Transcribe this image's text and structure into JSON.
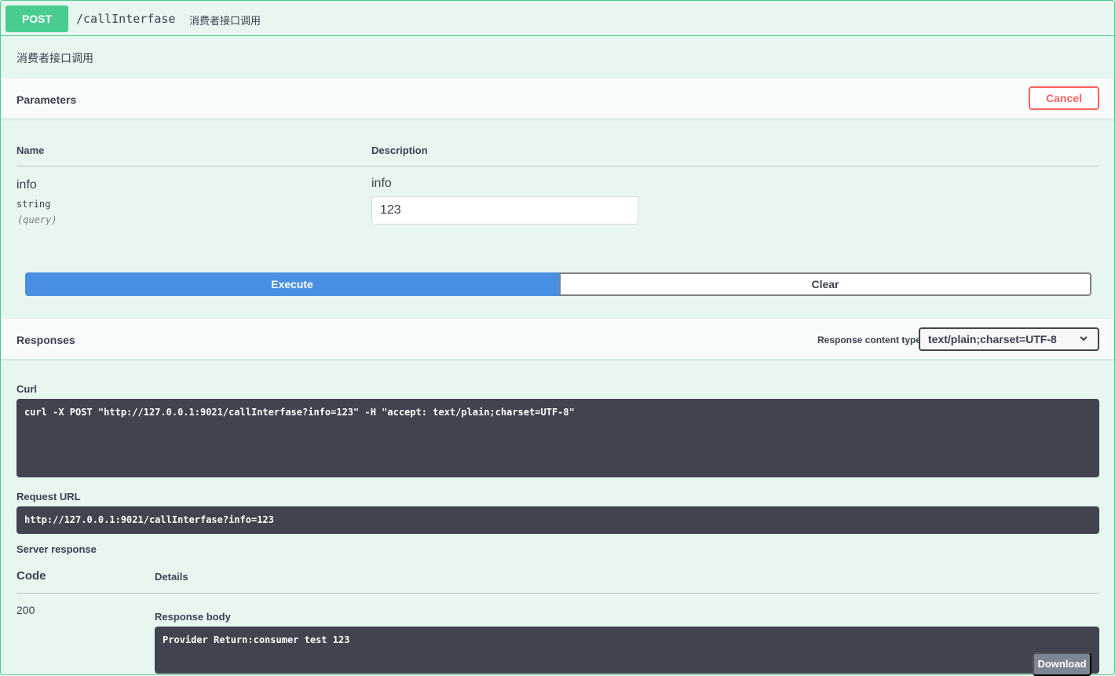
{
  "operation": {
    "method": "POST",
    "path": "/callInterfase",
    "summary": "消费者接口调用",
    "description": "消费者接口调用"
  },
  "parameters": {
    "title": "Parameters",
    "cancel_label": "Cancel",
    "col_name": "Name",
    "col_description": "Description",
    "items": [
      {
        "name": "info",
        "type": "string",
        "in": "(query)",
        "description": "info",
        "value": "123"
      }
    ]
  },
  "actions": {
    "execute_label": "Execute",
    "clear_label": "Clear"
  },
  "responses": {
    "title": "Responses",
    "content_type_label": "Response content type",
    "content_type_value": "text/plain;charset=UTF-8",
    "curl_label": "Curl",
    "curl": "curl -X POST \"http://127.0.0.1:9021/callInterfase?info=123\" -H \"accept: text/plain;charset=UTF-8\"",
    "request_url_label": "Request URL",
    "request_url": "http://127.0.0.1:9021/callInterfase?info=123",
    "server_response_label": "Server response",
    "code_header": "Code",
    "details_header": "Details",
    "code": "200",
    "response_body_label": "Response body",
    "response_body": "Provider Return:consumer test 123",
    "download_label": "Download"
  },
  "colors": {
    "post_green": "#49cc90",
    "block_bg": "#e8f6f0",
    "execute_blue": "#4990e2",
    "cancel_red": "#ff6060",
    "code_bg": "#41444e"
  }
}
